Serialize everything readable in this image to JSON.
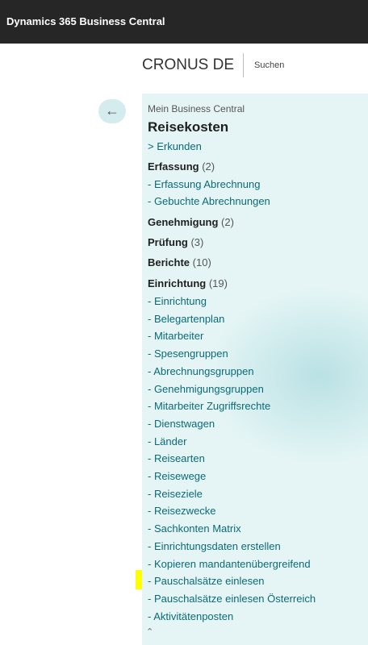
{
  "header": {
    "app_title": "Dynamics 365 Business Central"
  },
  "company_bar": {
    "company": "CRONUS DE",
    "search_label": "Suchen"
  },
  "back_icon": "←",
  "nav": {
    "breadcrumb": "Mein Business Central",
    "title": "Reisekosten",
    "explore": "> Erkunden",
    "sections": [
      {
        "label": "Erfassung",
        "count": "(2)"
      },
      {
        "label": "Genehmigung",
        "count": "(2)"
      },
      {
        "label": "Prüfung",
        "count": "(3)"
      },
      {
        "label": "Berichte",
        "count": "(10)"
      },
      {
        "label": "Einrichtung",
        "count": "(19)"
      }
    ],
    "erfassung_items": [
      "- Erfassung Abrechnung",
      "- Gebuchte Abrechnungen"
    ],
    "einrichtung_items": [
      "- Einrichtung",
      "- Belegartenplan",
      "- Mitarbeiter",
      "- Spesengruppen",
      "- Abrechnungsgruppen",
      "- Genehmigungsgruppen",
      "- Mitarbeiter Zugriffsrechte",
      "- Dienstwagen",
      "- Länder",
      "- Reisearten",
      "- Reisewege",
      "- Reiseziele",
      "- Reisezwecke",
      "- Sachkonten Matrix",
      "- Einrichtungsdaten erstellen",
      "- Kopieren mandantenübergreifend",
      "- Pauschalsätze einlesen",
      "- Pauschalsätze einlesen Österreich",
      "- Aktivitätenposten"
    ],
    "highlight_color": "#ffff00",
    "collapse_icon": "⌃"
  },
  "colors": {
    "topbar": "#262626",
    "panel": "#e5f5f5",
    "link": "#0b6a78"
  }
}
